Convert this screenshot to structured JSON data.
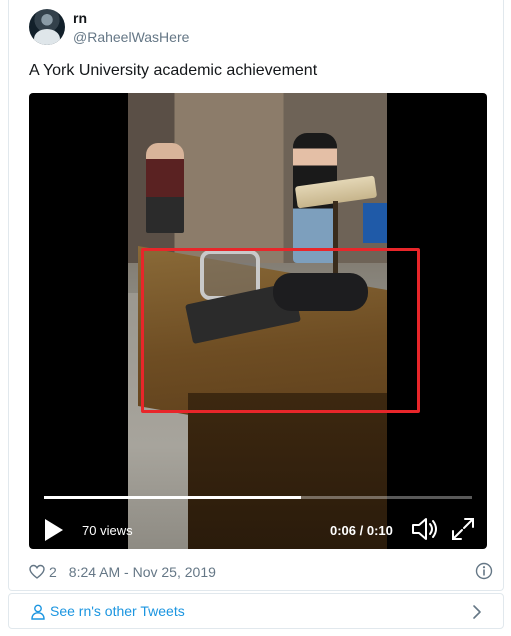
{
  "author": {
    "name": "rn",
    "handle": "@RaheelWasHere",
    "avatar_icon": "profile-avatar"
  },
  "tweet": {
    "text": "A York University academic achievement"
  },
  "video": {
    "views_label": "70 views",
    "time_label": "0:06 / 0:10",
    "progress": 0.6,
    "highlight_color": "#e8262a",
    "play_icon": "play-icon",
    "volume_icon": "volume-icon",
    "fullscreen_icon": "fullscreen-icon"
  },
  "meta": {
    "like_count": "2",
    "timestamp": "8:24 AM - Nov 25, 2019",
    "like_icon": "heart-icon",
    "info_icon": "info-icon"
  },
  "footer": {
    "other_tweets_label": "See rn's other Tweets",
    "link_color": "#1b95e0",
    "person_icon": "person-icon",
    "chevron_icon": "chevron-right-icon"
  }
}
